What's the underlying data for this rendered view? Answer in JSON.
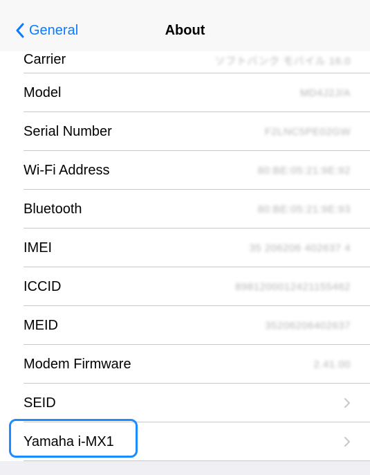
{
  "nav": {
    "back_label": "General",
    "title": "About"
  },
  "rows": [
    {
      "label": "Carrier",
      "value": "ソフトバンク モバイル 16.0"
    },
    {
      "label": "Model",
      "value": "MD4J2J/A"
    },
    {
      "label": "Serial Number",
      "value": "F2LNC5PE02GW"
    },
    {
      "label": "Wi-Fi Address",
      "value": "80:BE:05:21:9E:92"
    },
    {
      "label": "Bluetooth",
      "value": "80:BE:05:21:9E:93"
    },
    {
      "label": "IMEI",
      "value": "35 206206 402637 4"
    },
    {
      "label": "ICCID",
      "value": "8981200012421155462"
    },
    {
      "label": "MEID",
      "value": "35206206402637"
    },
    {
      "label": "Modem Firmware",
      "value": "2.41.00"
    },
    {
      "label": "SEID",
      "value": ""
    },
    {
      "label": "Yamaha i-MX1",
      "value": ""
    }
  ],
  "colors": {
    "accent": "#0a7aff",
    "highlight": "#1a8cff"
  }
}
